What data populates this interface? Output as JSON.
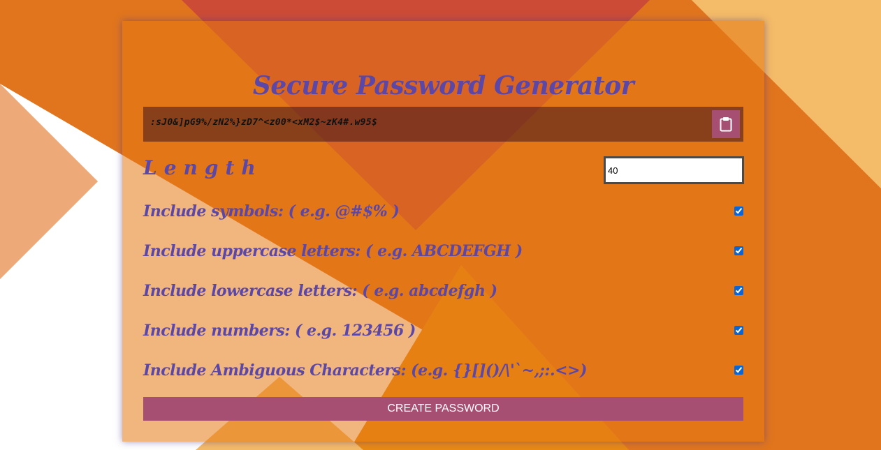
{
  "header": {
    "title": "Secure Password Generator"
  },
  "password": {
    "value": ":sJ0&]pG9%/zN2%}zD7^<z00*<xM2$~zK4#.w95$",
    "copy_icon": "clipboard-icon"
  },
  "length": {
    "label": "Length",
    "value": "40"
  },
  "options": [
    {
      "label": "Include symbols: ( e.g. @#$% )",
      "checked": true
    },
    {
      "label": "Include uppercase letters: ( e.g. ABCDEFGH )",
      "checked": true
    },
    {
      "label": "Include lowercase letters: ( e.g. abcdefgh )",
      "checked": true
    },
    {
      "label": "Include numbers: ( e.g. 123456 )",
      "checked": true
    },
    {
      "label": "Include Ambiguous Characters: (e.g. {}[]()/\\'`~,;:.<>)",
      "checked": true
    }
  ],
  "create_button": {
    "label": "CREATE PASSWORD"
  },
  "colors": {
    "accent": "#a74f73",
    "title": "#5b47a8",
    "background_orange": "#e0751e"
  }
}
